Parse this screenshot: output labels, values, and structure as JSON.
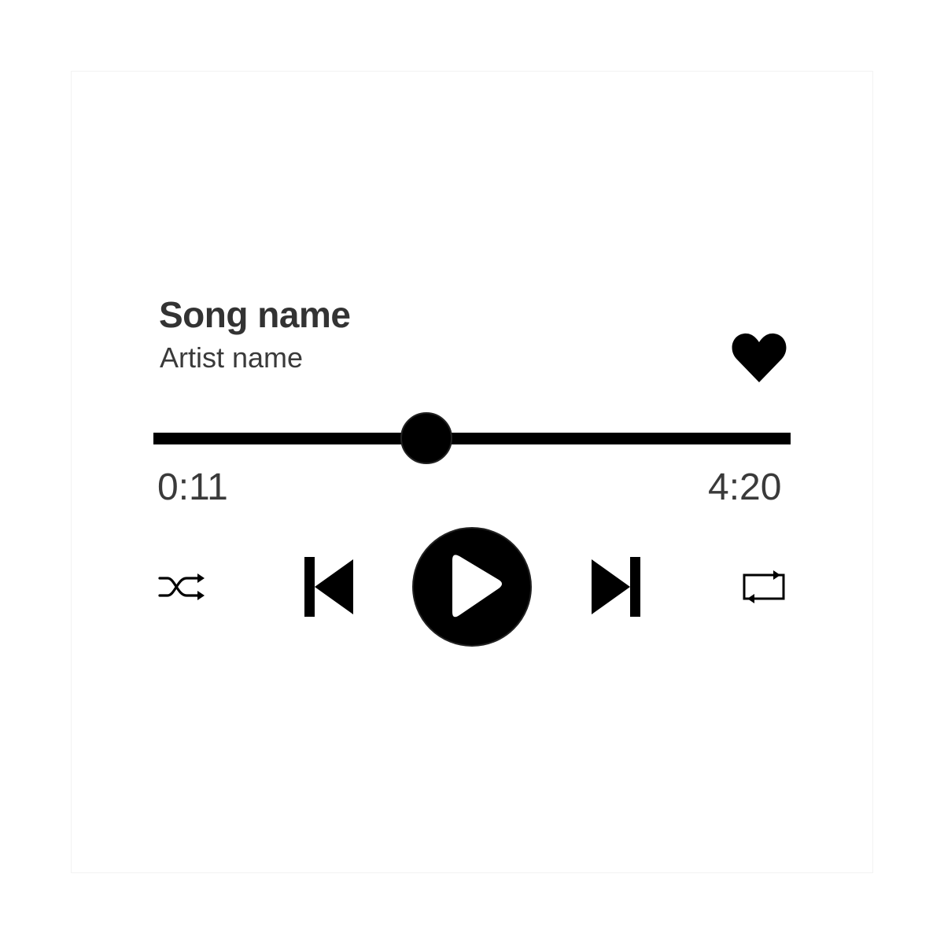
{
  "track": {
    "title": "Song name",
    "artist": "Artist name",
    "current_time": "0:11",
    "total_time": "4:20",
    "progress_fraction": 0.428,
    "liked": true
  },
  "controls": {
    "shuffle_icon": "shuffle-icon",
    "previous_icon": "skip-previous-icon",
    "play_icon": "play-icon",
    "next_icon": "skip-next-icon",
    "repeat_icon": "repeat-icon",
    "like_icon": "heart-icon"
  },
  "colors": {
    "foreground": "#000000",
    "text": "#333333",
    "background": "#ffffff"
  }
}
